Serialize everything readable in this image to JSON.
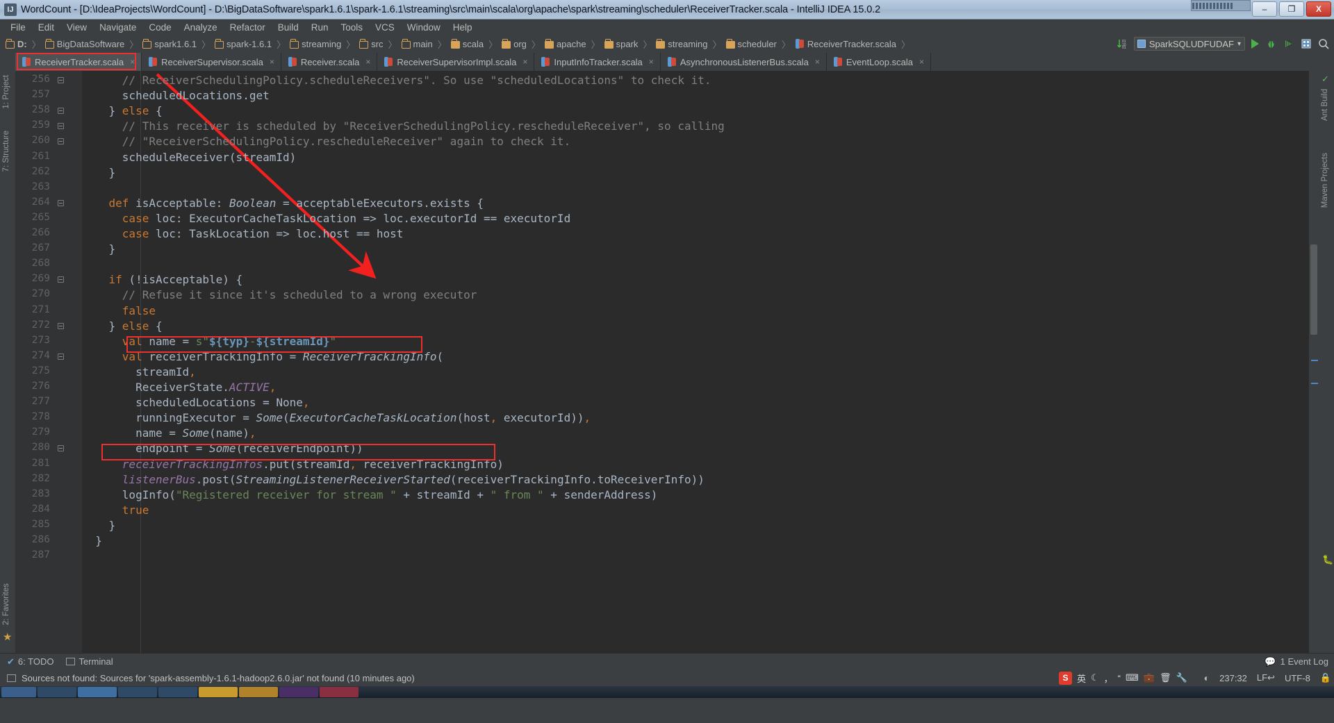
{
  "window": {
    "title": "WordCount - [D:\\IdeaProjects\\WordCount] - D:\\BigDataSoftware\\spark1.6.1\\spark-1.6.1\\streaming\\src\\main\\scala\\org\\apache\\spark\\streaming\\scheduler\\ReceiverTracker.scala - IntelliJ IDEA 15.0.2",
    "app_icon": "intellij-idea-icon",
    "buttons": {
      "minimize": "–",
      "maximize": "❐",
      "close": "X"
    }
  },
  "menu": {
    "items": [
      "File",
      "Edit",
      "View",
      "Navigate",
      "Code",
      "Analyze",
      "Refactor",
      "Build",
      "Run",
      "Tools",
      "VCS",
      "Window",
      "Help"
    ]
  },
  "breadcrumb": {
    "items": [
      {
        "label": "D:",
        "icon": "folder-icon"
      },
      {
        "label": "BigDataSoftware",
        "icon": "folder-icon"
      },
      {
        "label": "spark1.6.1",
        "icon": "folder-icon"
      },
      {
        "label": "spark-1.6.1",
        "icon": "folder-icon"
      },
      {
        "label": "streaming",
        "icon": "folder-icon"
      },
      {
        "label": "src",
        "icon": "folder-icon"
      },
      {
        "label": "main",
        "icon": "folder-icon"
      },
      {
        "label": "scala",
        "icon": "source-folder-icon"
      },
      {
        "label": "org",
        "icon": "source-folder-icon"
      },
      {
        "label": "apache",
        "icon": "source-folder-icon"
      },
      {
        "label": "spark",
        "icon": "source-folder-icon"
      },
      {
        "label": "streaming",
        "icon": "source-folder-icon"
      },
      {
        "label": "scheduler",
        "icon": "source-folder-icon"
      },
      {
        "label": "ReceiverTracker.scala",
        "icon": "scala-file-icon"
      }
    ]
  },
  "toolbar": {
    "sort_icon": "sort-numeric-icon",
    "run_config": "SparkSQLUDFUDAF",
    "run_config_caret": "▾",
    "run_icon": "run-icon",
    "debug_icon": "debug-icon",
    "coverage_icon": "run-with-coverage-icon",
    "layout_icon": "project-structure-icon",
    "search_icon": "search-everywhere-icon"
  },
  "editor_tabs": [
    {
      "label": "ReceiverTracker.scala",
      "active": true,
      "close": "×",
      "icon": "scala-file-icon"
    },
    {
      "label": "ReceiverSupervisor.scala",
      "active": false,
      "close": "×",
      "icon": "scala-file-icon"
    },
    {
      "label": "Receiver.scala",
      "active": false,
      "close": "×",
      "icon": "scala-file-icon"
    },
    {
      "label": "ReceiverSupervisorImpl.scala",
      "active": false,
      "close": "×",
      "icon": "scala-file-icon"
    },
    {
      "label": "InputInfoTracker.scala",
      "active": false,
      "close": "×",
      "icon": "scala-file-icon"
    },
    {
      "label": "AsynchronousListenerBus.scala",
      "active": false,
      "close": "×",
      "icon": "scala-file-icon"
    },
    {
      "label": "EventLoop.scala",
      "active": false,
      "close": "×",
      "icon": "scala-file-icon"
    }
  ],
  "left_rail": {
    "items": [
      "1: Project",
      "7: Structure",
      "2: Favorites"
    ]
  },
  "right_rail": {
    "items": [
      "Ant Build",
      "Maven Projects"
    ]
  },
  "editor": {
    "first_line": 256,
    "lines": [
      {
        "n": 256,
        "html": "      <span class='cmt'>// ReceiverSchedulingPolicy.scheduleReceivers\". So use \"scheduledLocations\" to check it.</span>"
      },
      {
        "n": 257,
        "html": "      scheduledLocations.get"
      },
      {
        "n": 258,
        "html": "    } <span class='kw'>else</span> {"
      },
      {
        "n": 259,
        "html": "      <span class='cmt'>// This receiver is scheduled by \"ReceiverSchedulingPolicy.rescheduleReceiver\", so calling</span>"
      },
      {
        "n": 260,
        "html": "      <span class='cmt'>// \"ReceiverSchedulingPolicy.rescheduleReceiver\" again to check it.</span>"
      },
      {
        "n": 261,
        "html": "      scheduleReceiver(streamId)"
      },
      {
        "n": 262,
        "html": "    }"
      },
      {
        "n": 263,
        "html": ""
      },
      {
        "n": 264,
        "html": "    <span class='kw'>def</span> isAcceptable: <span class='ital'>Boolean</span> = acceptableExecutors.exists {"
      },
      {
        "n": 265,
        "html": "      <span class='kw'>case</span> loc: ExecutorCacheTaskLocation =&gt; loc.executorId == executorId"
      },
      {
        "n": 266,
        "html": "      <span class='kw'>case</span> loc: TaskLocation =&gt; loc.host == host"
      },
      {
        "n": 267,
        "html": "    }"
      },
      {
        "n": 268,
        "html": ""
      },
      {
        "n": 269,
        "html": "    <span class='kw'>if</span> (!isAcceptable) {"
      },
      {
        "n": 270,
        "html": "      <span class='cmt'>// Refuse it since it's scheduled to a wrong executor</span>"
      },
      {
        "n": 271,
        "html": "      <span class='kw'>false</span>"
      },
      {
        "n": 272,
        "html": "    } <span class='kw'>else</span> {"
      },
      {
        "n": 273,
        "html": "      <span class='kw'>val</span> name = <span class='sprefix'>s</span><span class='str'>\"</span><span class='tmpl'>${</span><span class='tmpl'>typ</span><span class='tmpl'>}</span><span class='str'>-</span><span class='tmpl'>${</span><span class='tmpl'>streamId</span><span class='tmpl'>}</span><span class='str'>\"</span>"
      },
      {
        "n": 274,
        "html": "      <span class='kw'>val</span> receiverTrackingInfo = <span class='ital'>ReceiverTrackingInfo</span>("
      },
      {
        "n": 275,
        "html": "        streamId<span class='punct'>,</span>"
      },
      {
        "n": 276,
        "html": "        ReceiverState.<span class='stat'>ACTIVE</span><span class='punct'>,</span>"
      },
      {
        "n": 277,
        "html": "        scheduledLocations = None<span class='punct'>,</span>"
      },
      {
        "n": 278,
        "html": "        runningExecutor = <span class='ital'>Some</span>(<span class='ital'>ExecutorCacheTaskLocation</span>(host<span class='punct'>,</span> executorId))<span class='punct'>,</span>"
      },
      {
        "n": 279,
        "html": "        name = <span class='ital'>Some</span>(name)<span class='punct'>,</span>"
      },
      {
        "n": 280,
        "html": "        endpoint = <span class='ital'>Some</span>(receiverEndpoint))"
      },
      {
        "n": 281,
        "html": "      <span class='field'>receiverTrackingInfos</span>.put(streamId<span class='punct'>,</span> receiverTrackingInfo)"
      },
      {
        "n": 282,
        "html": "      <span class='field'>listenerBus</span>.post(<span class='ital'>StreamingListenerReceiverStarted</span>(receiverTrackingInfo.toReceiverInfo))"
      },
      {
        "n": 283,
        "html": "      logInfo(<span class='str'>\"Registered receiver for stream \"</span> + streamId + <span class='str'>\" from \"</span> + senderAddress)"
      },
      {
        "n": 284,
        "html": "      <span class='kw'>true</span>"
      },
      {
        "n": 285,
        "html": "    }"
      },
      {
        "n": 286,
        "html": "  }"
      },
      {
        "n": 287,
        "html": ""
      }
    ],
    "annotations": {
      "highlight_color": "#ee2f2f",
      "boxes": [
        {
          "name": "tab-highlight",
          "label": "ReceiverTracker.scala"
        },
        {
          "name": "line-274-highlight",
          "label": "receiverTrackingInfo = ReceiverTrackingInfo"
        },
        {
          "name": "line-281-highlight",
          "label": "receiverTrackingInfos.put(streamId, receiverTrackingInfo)"
        }
      ],
      "arrow": {
        "name": "annotation-arrow",
        "from": "tab ReceiverTracker.scala",
        "to": "line 274"
      }
    }
  },
  "bottom_bar": {
    "todo": "6: TODO",
    "terminal": "Terminal",
    "event_log": "1 Event Log"
  },
  "status_bar": {
    "message": "Sources not found: Sources for 'spark-assembly-1.6.1-hadoop2.6.0.jar' not found (10 minutes ago)",
    "caret_position": "237:32",
    "line_separator": "LF↩",
    "encoding": "UTF-8",
    "lock_icon": "lock-icon",
    "inspection_icon": "inspection-icon",
    "ime": {
      "lang": "英",
      "items": [
        "moon-icon",
        "comma-icon",
        "quote-icon",
        "keyboard-icon",
        "toolbox-icon",
        "trash-icon",
        "wrench-icon"
      ]
    }
  }
}
